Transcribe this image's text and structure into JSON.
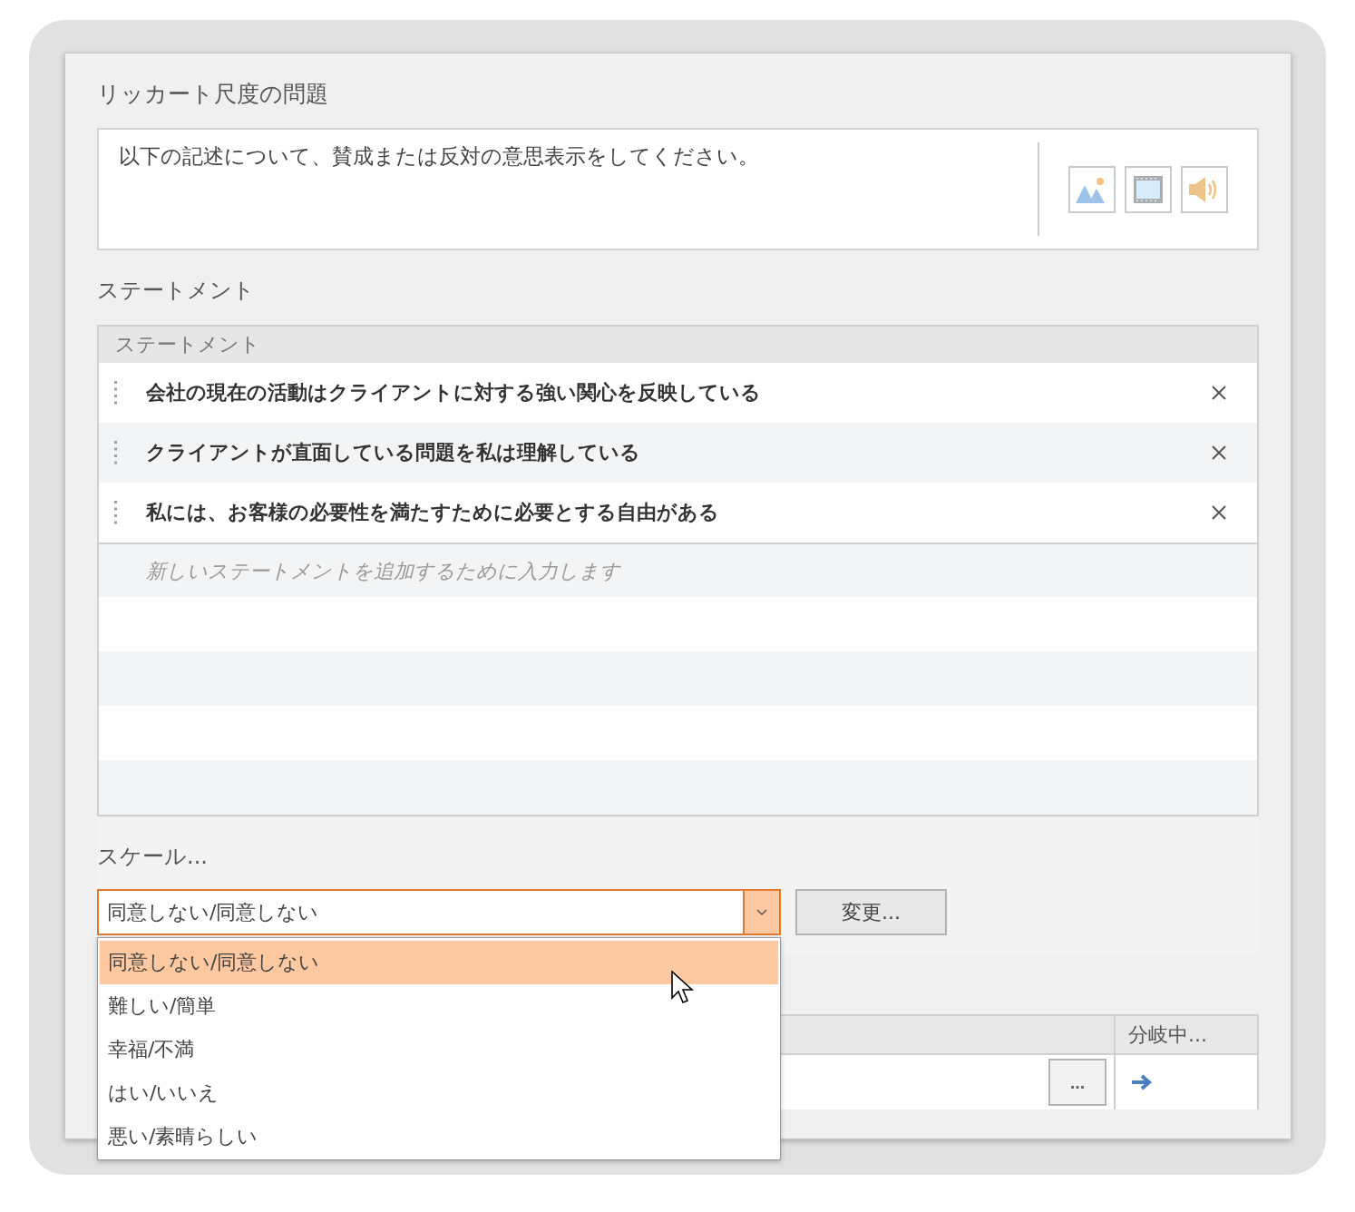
{
  "question": {
    "title": "リッカート尺度の問題",
    "text": "以下の記述について、賛成または反対の意思表示をしてください。"
  },
  "statements": {
    "label": "ステートメント",
    "column": "ステートメント",
    "rows": [
      {
        "text": "会社の現在の活動はクライアントに対する強い関心を反映している"
      },
      {
        "text": "クライアントが直面している問題を私は理解している"
      },
      {
        "text": "私には、お客様の必要性を満たすために必要とする自由がある"
      }
    ],
    "placeholder": "新しいステートメントを追加するために入力します"
  },
  "scale": {
    "label": "スケール...",
    "value": "同意しない/同意しない",
    "change_button": "変更...",
    "options": [
      {
        "label": "同意しない/同意しない",
        "selected": true
      },
      {
        "label": "難しい/簡単",
        "selected": false
      },
      {
        "label": "幸福/不満",
        "selected": false
      },
      {
        "label": "はい/いいえ",
        "selected": false
      },
      {
        "label": "悪い/素晴らしい",
        "selected": false
      }
    ]
  },
  "branching": {
    "column": "分岐中...",
    "more_button": "..."
  }
}
